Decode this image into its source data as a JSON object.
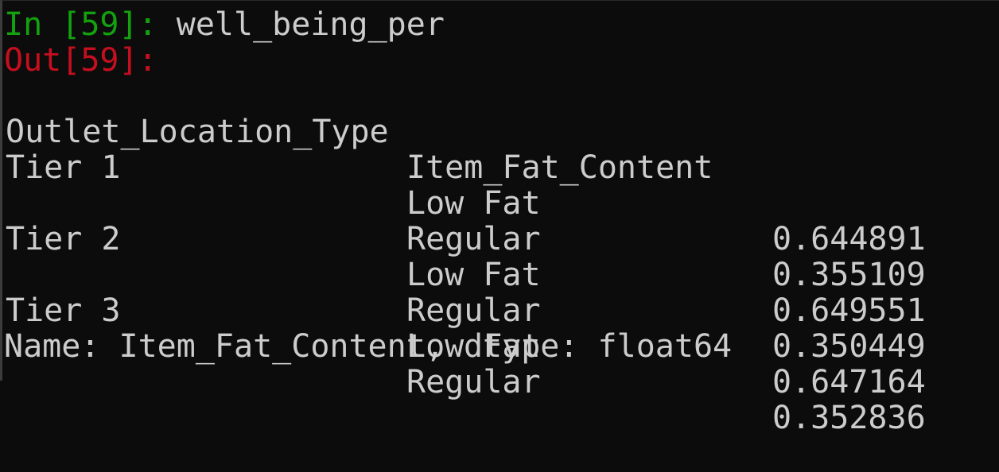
{
  "input_prompt": {
    "prefix": "In [",
    "number": "59",
    "suffix": "]: ",
    "command": "well_being_per"
  },
  "output_prompt": {
    "prefix": "Out[",
    "number": "59",
    "suffix": "]:"
  },
  "headers": {
    "index_name": "Outlet_Location_Type",
    "sub_index_name": "Item_Fat_Content"
  },
  "rows": [
    {
      "tier": "Tier 1",
      "fat": "Low Fat",
      "value": "0.644891"
    },
    {
      "tier": "",
      "fat": "Regular",
      "value": "0.355109"
    },
    {
      "tier": "Tier 2",
      "fat": "Low Fat",
      "value": "0.649551"
    },
    {
      "tier": "",
      "fat": "Regular",
      "value": "0.350449"
    },
    {
      "tier": "Tier 3",
      "fat": "Low Fat",
      "value": "0.647164"
    },
    {
      "tier": "",
      "fat": "Regular",
      "value": "0.352836"
    }
  ],
  "footer": "Name: Item_Fat_Content, dtype: float64",
  "colors": {
    "background": "#0c0c0c",
    "text": "#cccccc",
    "in_prompt": "#13a10e",
    "out_prompt": "#c50f1f"
  }
}
